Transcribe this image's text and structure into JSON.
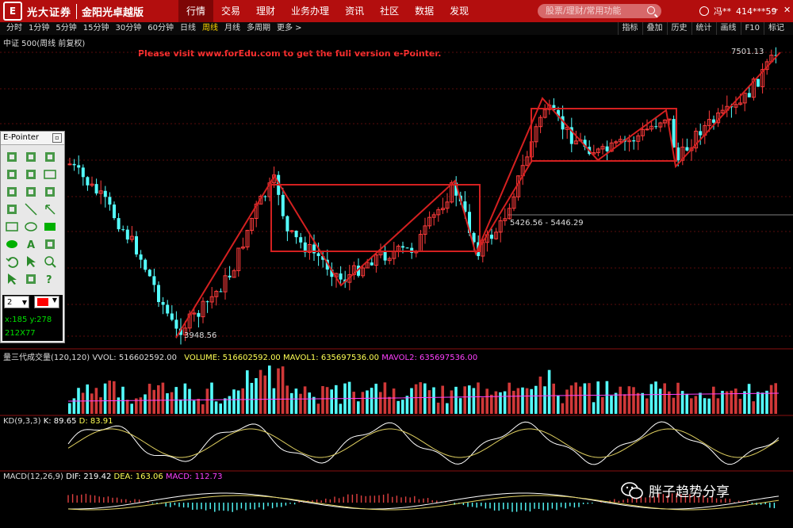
{
  "app": {
    "logo_mark": "E",
    "logo_text": "光大证券",
    "logo_sub": "金阳光卓越版"
  },
  "nav": [
    "行情",
    "交易",
    "理财",
    "业务办理",
    "资讯",
    "社区",
    "数据",
    "发现"
  ],
  "search": {
    "placeholder": "股票/理财/常用功能"
  },
  "user": {
    "name": "冯**",
    "account": "414***59"
  },
  "periods": [
    "分时",
    "1分钟",
    "5分钟",
    "15分钟",
    "30分钟",
    "60分钟",
    "日线",
    "周线",
    "月线",
    "多周期",
    "更多 >"
  ],
  "active_period": "周线",
  "tools": [
    "指标",
    "叠加",
    "历史",
    "统计",
    "画线",
    "F10",
    "标记"
  ],
  "chart_title": "中证 500(周线 前复权)",
  "watermark": "Please visit www.forEdu.com to get the full version e-Pointer.",
  "price_labels": {
    "high": "7501.13",
    "low": "3948.56",
    "range": "5426.56 - 5446.29"
  },
  "volume_line": {
    "name": "量三代成交量(120,120)",
    "vol": "VVOL: 516602592.00",
    "volume": "VOLUME: 516602592.00",
    "mavol1": "MAVOL1: 635697536.00",
    "mavol2": "MAVOL2: 635697536.00"
  },
  "kd_line": {
    "name": "KD(9,3,3)",
    "k": "K: 89.65",
    "d": "D: 83.91"
  },
  "macd_line": {
    "name": "MACD(12,26,9)",
    "dif": "DIF: 219.42",
    "dea": "DEA: 163.06",
    "macd": "MACD: 112.73"
  },
  "epointer": {
    "title": "E-Pointer",
    "width_value": "2",
    "coords": "x:185    y:278",
    "size": "212X77"
  },
  "wechat": {
    "label": "胖子趋势分享"
  },
  "colors": {
    "up": "#ff3b3b",
    "down": "#54ffff",
    "line": "#d42020",
    "brand": "#b30e0e"
  }
}
